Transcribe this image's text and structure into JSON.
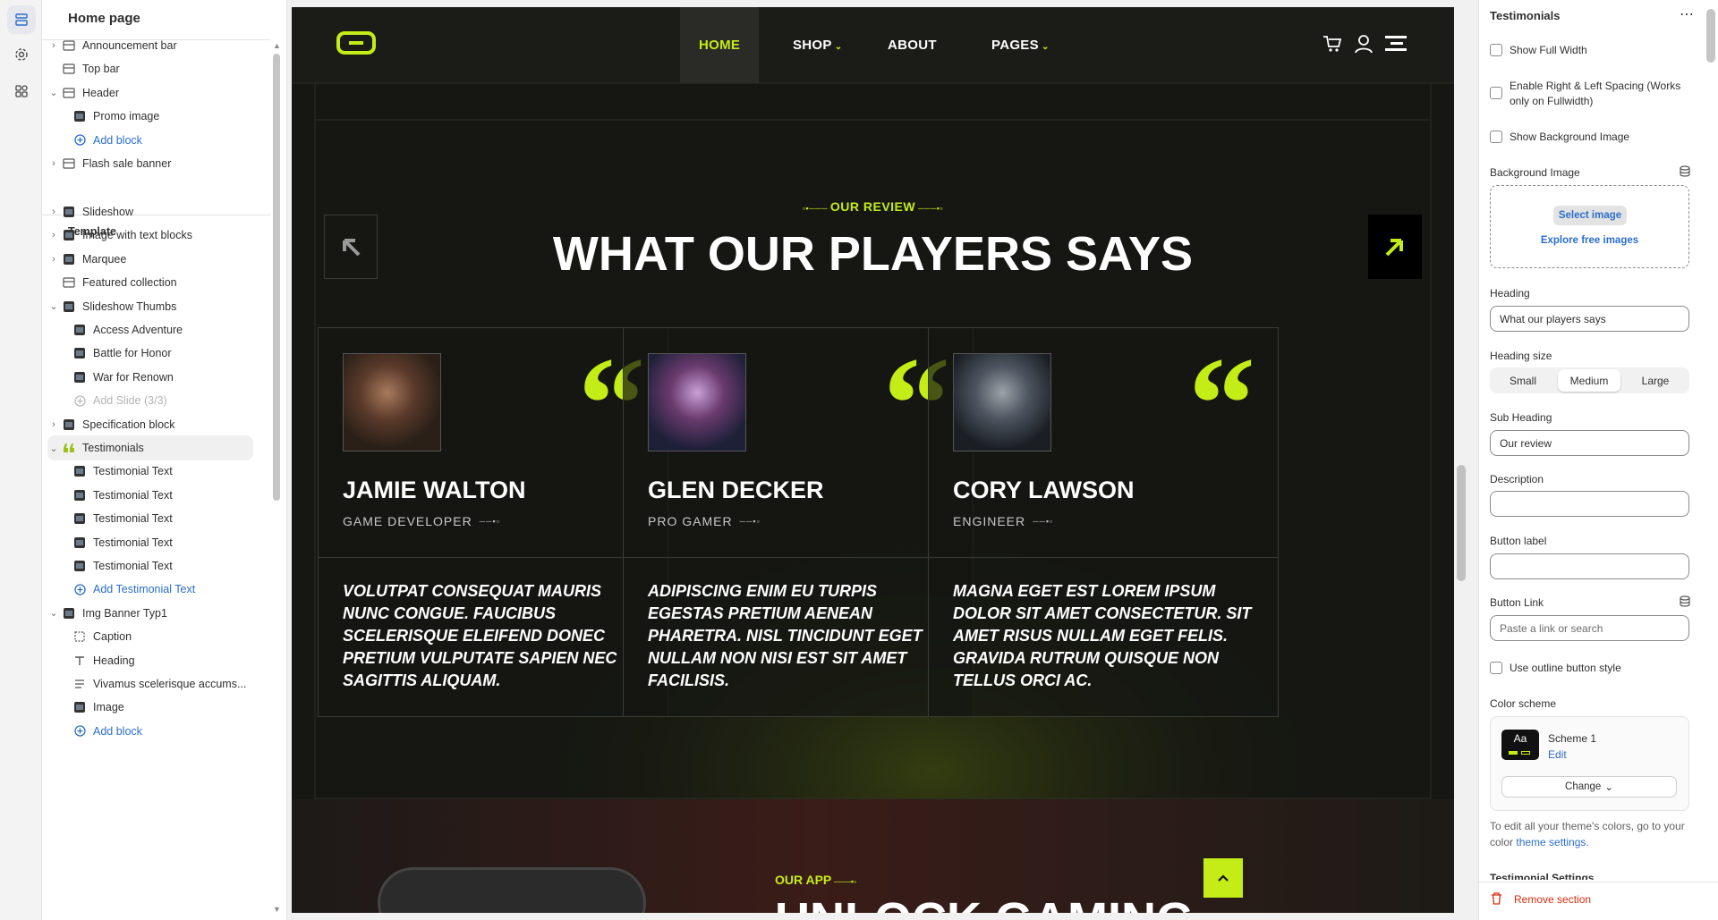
{
  "sidebar": {
    "title": "Home page",
    "header_group": [
      {
        "label": "Announcement bar",
        "expandable": true
      },
      {
        "label": "Top bar",
        "expandable": false
      },
      {
        "label": "Header",
        "expandable": true,
        "expanded": true
      },
      {
        "label": "Promo image",
        "child": true
      },
      {
        "label": "Add block",
        "child": true,
        "link": true
      },
      {
        "label": "Flash sale banner",
        "expandable": true
      }
    ],
    "template_label": "Template",
    "template_items": [
      {
        "label": "Slideshow",
        "expandable": true
      },
      {
        "label": "Image with text blocks",
        "expandable": true
      },
      {
        "label": "Marquee",
        "expandable": true
      },
      {
        "label": "Featured collection",
        "expandable": false
      },
      {
        "label": "Slideshow Thumbs",
        "expandable": true,
        "expanded": true
      },
      {
        "label": "Access Adventure",
        "child": true
      },
      {
        "label": "Battle for Honor",
        "child": true
      },
      {
        "label": "War for Renown",
        "child": true
      },
      {
        "label": "Add Slide (3/3)",
        "child": true,
        "disabled": true
      },
      {
        "label": "Specification block",
        "expandable": true
      },
      {
        "label": "Testimonials",
        "expandable": true,
        "expanded": true,
        "selected": true
      },
      {
        "label": "Testimonial Text",
        "child": true
      },
      {
        "label": "Testimonial Text",
        "child": true
      },
      {
        "label": "Testimonial Text",
        "child": true
      },
      {
        "label": "Testimonial Text",
        "child": true
      },
      {
        "label": "Testimonial Text",
        "child": true
      },
      {
        "label": "Add Testimonial Text",
        "child": true,
        "link": true
      },
      {
        "label": "Img Banner Typ1",
        "expandable": true,
        "expanded": true
      },
      {
        "label": "Caption",
        "child": true
      },
      {
        "label": "Heading",
        "child": true
      },
      {
        "label": "Vivamus scelerisque accums...",
        "child": true
      },
      {
        "label": "Image",
        "child": true
      },
      {
        "label": "Add block",
        "child": true,
        "link": true
      }
    ]
  },
  "store": {
    "nav": {
      "home": "HOME",
      "shop": "SHOP",
      "about": "ABOUT",
      "pages": "PAGES"
    },
    "section": {
      "subheading": "OUR REVIEW",
      "heading": "WHAT OUR PLAYERS SAYS"
    },
    "testimonials": [
      {
        "name": "JAMIE WALTON",
        "role": "GAME DEVELOPER",
        "text": "VOLUTPAT CONSEQUAT MAURIS NUNC CONGUE. FAUCIBUS SCELERISQUE ELEIFEND DONEC PRETIUM VULPUTATE SAPIEN NEC SAGITTIS ALIQUAM."
      },
      {
        "name": "GLEN DECKER",
        "role": "PRO GAMER",
        "text": "ADIPISCING ENIM EU TURPIS EGESTAS PRETIUM AENEAN PHARETRA. NISL TINCIDUNT EGET NULLAM NON NISI EST SIT AMET FACILISIS."
      },
      {
        "name": "CORY LAWSON",
        "role": "ENGINEER",
        "text": "MAGNA EGET EST LOREM IPSUM DOLOR SIT AMET CONSECTETUR. SIT AMET RISUS NULLAM EGET FELIS. GRAVIDA RUTRUM QUISQUE NON TELLUS ORCI AC."
      }
    ],
    "app": {
      "subheading": "OUR APP",
      "heading_partial": "UNLOCK GAMING"
    }
  },
  "panel": {
    "title": "Testimonials",
    "show_full_width": "Show Full Width",
    "spacing": "Enable Right & Left Spacing (Works only on Fullwidth)",
    "show_bg": "Show Background Image",
    "bg_image_label": "Background Image",
    "select_image": "Select image",
    "explore_images": "Explore free images",
    "heading_label": "Heading",
    "heading_value": "What our players says",
    "heading_size_label": "Heading size",
    "sizes": [
      "Small",
      "Medium",
      "Large"
    ],
    "selected_size": "Medium",
    "subheading_label": "Sub Heading",
    "subheading_value": "Our review",
    "description_label": "Description",
    "button_label_label": "Button label",
    "button_link_label": "Button Link",
    "button_link_placeholder": "Paste a link or search",
    "outline_label": "Use outline button style",
    "color_scheme_label": "Color scheme",
    "scheme_name": "Scheme 1",
    "scheme_edit": "Edit",
    "scheme_change": "Change",
    "help_text": "To edit all your theme's colors, go to your color",
    "help_link": "theme settings.",
    "next_label": "Testimonial Settings",
    "remove_section": "Remove section",
    "accent": "#c4ec17",
    "link_color": "#2c6ecb",
    "danger": "#d72c0d"
  }
}
